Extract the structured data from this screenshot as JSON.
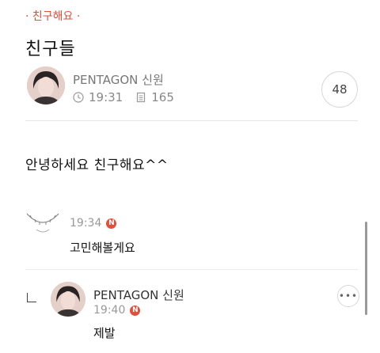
{
  "post": {
    "category": "· 친구해요 ·",
    "title": "친구들",
    "author": "PENTAGON 신원",
    "time": "19:31",
    "views": "165",
    "comment_count": "48",
    "body": "안녕하세요 친구해요^^"
  },
  "comments": [
    {
      "time": "19:34",
      "badge": "N",
      "text": "고민해볼게요"
    },
    {
      "author": "PENTAGON 신원",
      "time": "19:40",
      "badge": "N",
      "text": "제발"
    }
  ],
  "icons": {
    "clock": "clock-icon",
    "views": "document-icon",
    "more": "more-icon",
    "reply": "reply-icon"
  },
  "colors": {
    "accent": "#e0503b"
  }
}
